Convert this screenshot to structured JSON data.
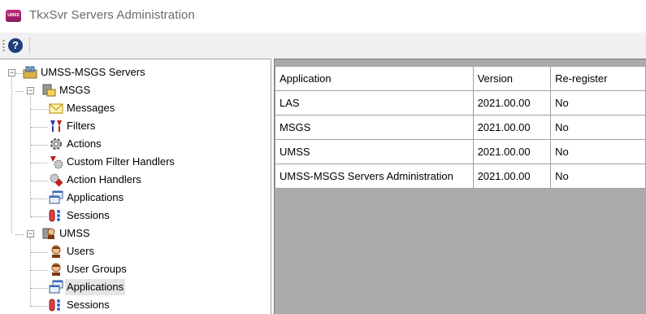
{
  "window": {
    "title": "TkxSvr Servers Administration",
    "icon_text": "UMSS"
  },
  "toolbar": {
    "help_glyph": "?"
  },
  "tree": {
    "root": "UMSS-MSGS Servers",
    "msgs": {
      "label": "MSGS",
      "children": [
        "Messages",
        "Filters",
        "Actions",
        "Custom Filter Handlers",
        "Action Handlers",
        "Applications",
        "Sessions"
      ]
    },
    "umss": {
      "label": "UMSS",
      "children": [
        "Users",
        "User Groups",
        "Applications",
        "Sessions"
      ]
    },
    "selected": "UMSS / Applications"
  },
  "grid": {
    "headers": [
      "Application",
      "Version",
      "Re-register"
    ],
    "rows": [
      [
        "LAS",
        "2021.00.00",
        "No"
      ],
      [
        "MSGS",
        "2021.00.00",
        "No"
      ],
      [
        "UMSS",
        "2021.00.00",
        "No"
      ],
      [
        "UMSS-MSGS Servers Administration",
        "2021.00.00",
        "No"
      ]
    ]
  },
  "colors": {
    "help": "#1e3f7a",
    "grid_empty": "#ababab",
    "selection": "#e5e5e5"
  }
}
